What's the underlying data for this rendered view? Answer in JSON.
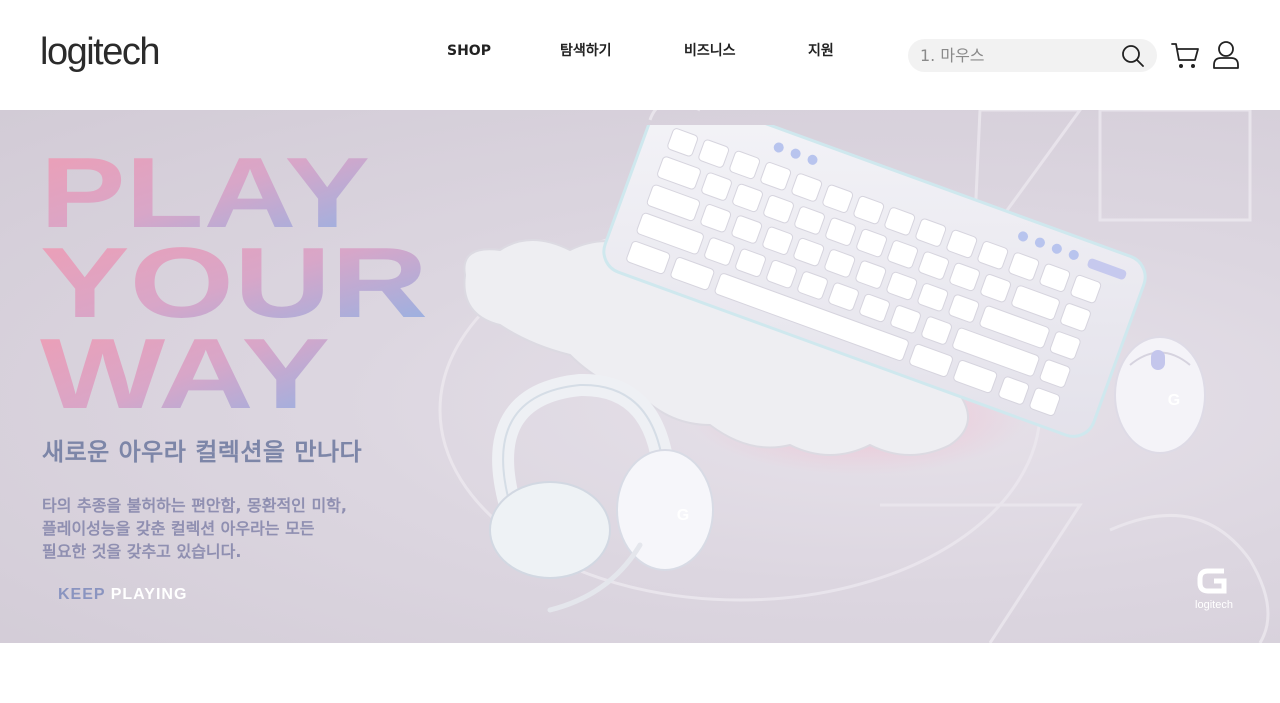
{
  "header": {
    "logo_text": "logitech",
    "nav": [
      {
        "label": "SHOP"
      },
      {
        "label": "탐색하기"
      },
      {
        "label": "비즈니스"
      },
      {
        "label": "지원"
      }
    ],
    "search": {
      "placeholder": "1. 마우스",
      "icon": "search-icon"
    },
    "cart_icon": "cart-icon",
    "account_icon": "account-icon"
  },
  "hero": {
    "headline_lines": [
      "PLAY",
      "YOUR",
      "WAY"
    ],
    "subtitle": "새로운 아우라 컬렉션을 만나다",
    "description_lines": [
      "타의 추종을 불허하는 편안함, 몽환적인 미학,",
      "플레이성능을 갖춘 컬렉션 아우라는 모든",
      "필요한 것을 갖추고 있습니다."
    ],
    "tagline_part1": "KEEP",
    "tagline_part2": "PLAYING",
    "brand_mark_text": "logitech",
    "colors": {
      "headline_pink": "#ec9fb6",
      "headline_blue": "#8fb1e6",
      "subtitle": "#7d86a8",
      "background": "#dcd6e0"
    }
  }
}
